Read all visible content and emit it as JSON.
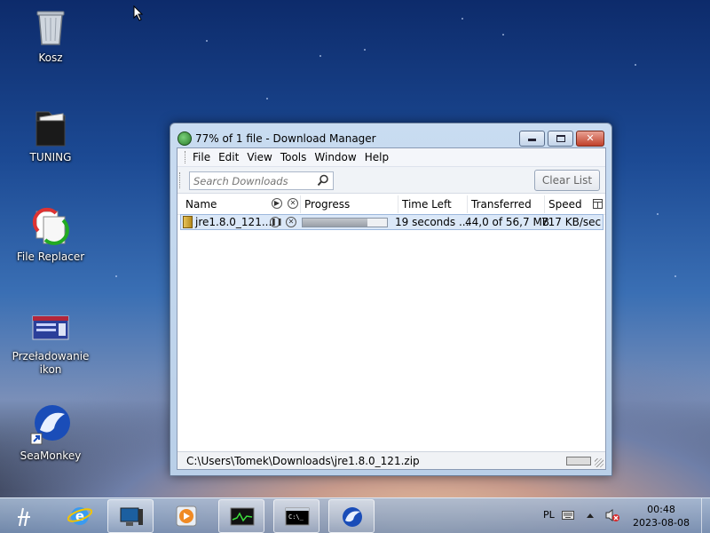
{
  "desktop": {
    "icons": [
      {
        "label": "Kosz"
      },
      {
        "label": "TUNING"
      },
      {
        "label": "File Replacer"
      },
      {
        "label": "Przeładowanie ikon"
      },
      {
        "label": "SeaMonkey"
      }
    ]
  },
  "window": {
    "title": "77% of 1 file - Download Manager",
    "controls": {
      "minimize": "▭",
      "maximize": "▢",
      "close": "✕"
    },
    "menu": [
      "File",
      "Edit",
      "View",
      "Tools",
      "Window",
      "Help"
    ],
    "search": {
      "placeholder": "Search Downloads",
      "value": ""
    },
    "clear_list": "Clear List",
    "columns": {
      "name": "Name",
      "progress": "Progress",
      "time_left": "Time Left",
      "transferred": "Transferred",
      "speed": "Speed"
    },
    "downloads": [
      {
        "name": "jre1.8.0_121....",
        "progress": 0.77,
        "time_left": "19 seconds ...",
        "transferred": "44,0 of 56,7 MB",
        "speed": "717 KB/sec"
      }
    ],
    "status_path": "C:\\Users\\Tomek\\Downloads\\jre1.8.0_121.zip"
  },
  "taskbar": {
    "language": "PL",
    "time": "00:48",
    "date": "2023-08-08"
  }
}
